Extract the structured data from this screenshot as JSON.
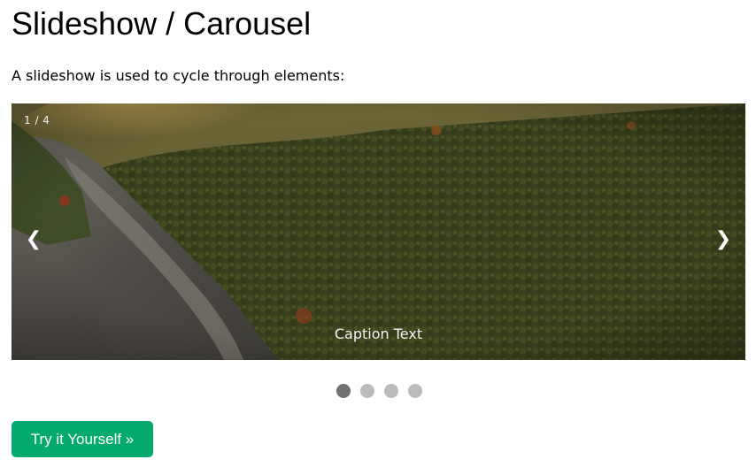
{
  "page": {
    "title": "Slideshow / Carousel",
    "intro": "A slideshow is used to cycle through elements:"
  },
  "slideshow": {
    "number_text": "1 / 4",
    "caption": "Caption Text",
    "prev_icon": "chevron-left-icon",
    "next_icon": "chevron-right-icon",
    "prev_glyph": "❮",
    "next_glyph": "❯",
    "total_slides": 4,
    "active_slide": 1
  },
  "dots": [
    {
      "active": true
    },
    {
      "active": false
    },
    {
      "active": false
    },
    {
      "active": false
    }
  ],
  "try_button": {
    "label": "Try it Yourself »",
    "color": "#04aa6d"
  },
  "colors": {
    "dot_active": "#717171",
    "dot_inactive": "#bbbbbb",
    "caption_text": "#f2f2f2"
  }
}
